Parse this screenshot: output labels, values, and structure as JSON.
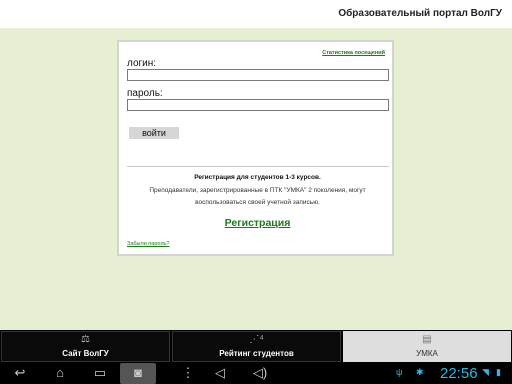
{
  "header": {
    "title": "Образовательный портал ВолГУ"
  },
  "login": {
    "stats_link": "Статистика посещений",
    "login_label": "логин:",
    "login_value": "",
    "password_label": "пароль:",
    "password_value": "",
    "submit_label": "войти",
    "info_bold": "Регистрация для студентов 1-3 курсов.",
    "info_text": "Преподаватели, зарегистрированные в ПТК \"УМКА\" 2 поколения, могут воспользоваться своей учетной записью.",
    "register_link": "Регистрация",
    "forgot_link": "Забыли пароль?"
  },
  "tabs": [
    {
      "label": "Сайт ВолГУ",
      "icon": "scales-icon",
      "active": false
    },
    {
      "label": "Рейтинг студентов",
      "icon": "rating-icon",
      "active": false
    },
    {
      "label": "УМКА",
      "icon": "book-icon",
      "active": true
    }
  ],
  "system_bar": {
    "clock": "22:56",
    "icons": [
      "back-icon",
      "home-icon",
      "recent-apps-icon",
      "screenshot-icon",
      "volume-down-icon",
      "volume-up-icon",
      "usb-icon",
      "android-debug-icon",
      "wifi-icon",
      "battery-icon"
    ]
  },
  "colors": {
    "background": "#e6efd1",
    "link_green": "#1c7a1c",
    "clock_blue": "#33b5e5"
  }
}
